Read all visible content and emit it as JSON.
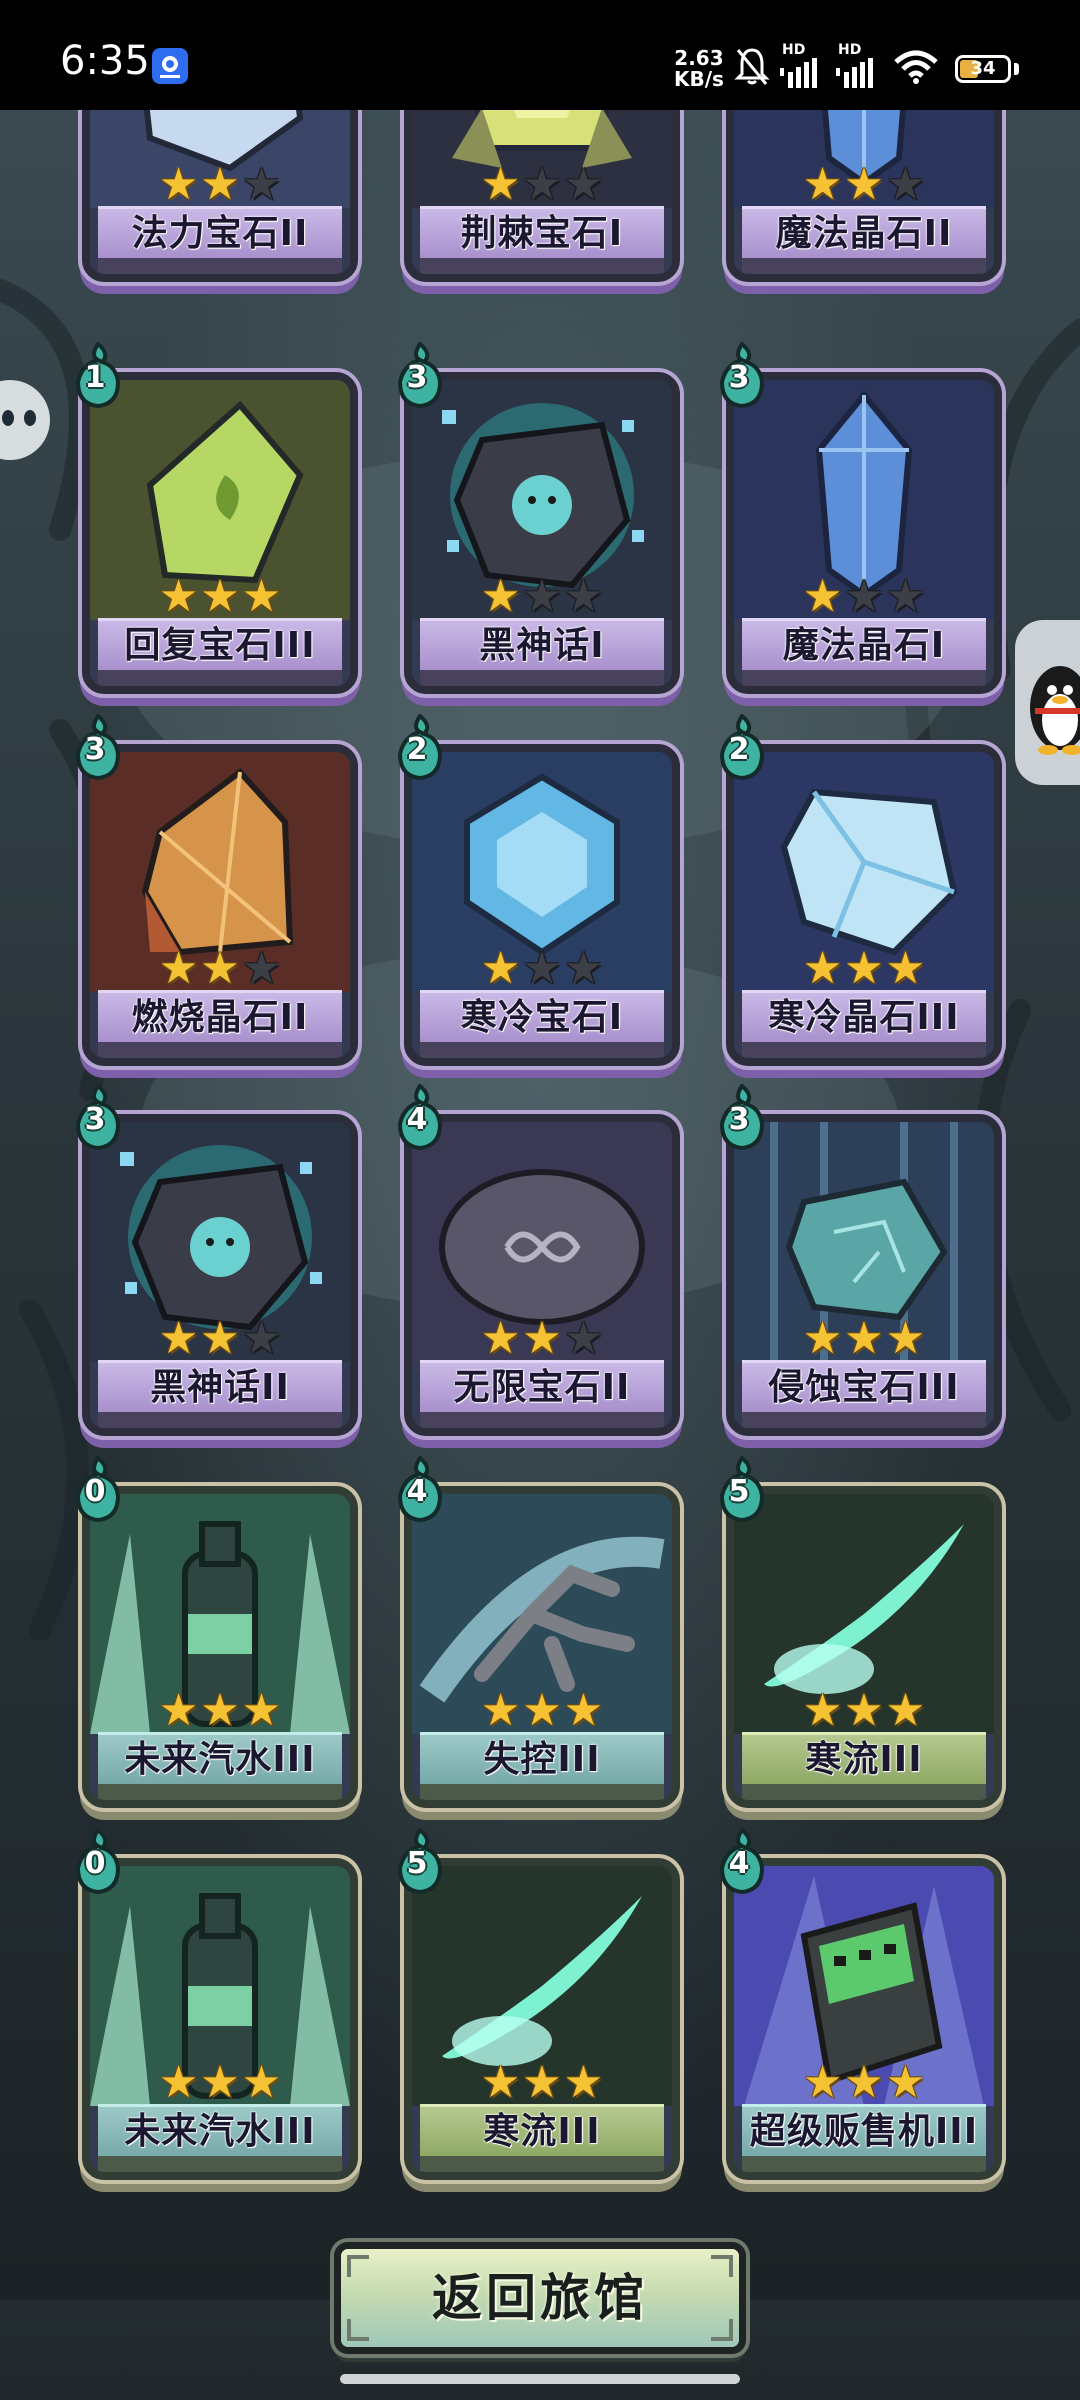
{
  "status_bar": {
    "time": "6:35",
    "speed_value": "2.63",
    "speed_unit": "KB/s",
    "network_1": "HD",
    "network_2": "HD",
    "battery": "34"
  },
  "cards": [
    {
      "name": "法力宝石II",
      "stars": 2,
      "cost": null,
      "kind": "item",
      "art": "stone-spiral"
    },
    {
      "name": "荆棘宝石I",
      "stars": 1,
      "cost": null,
      "kind": "item",
      "art": "gem-yellow"
    },
    {
      "name": "魔法晶石II",
      "stars": 2,
      "cost": null,
      "kind": "item",
      "art": "crystal-blue"
    },
    {
      "name": "回复宝石III",
      "stars": 3,
      "cost": "1",
      "kind": "item",
      "art": "gem-green"
    },
    {
      "name": "黑神话I",
      "stars": 1,
      "cost": "3",
      "kind": "item",
      "art": "dark-stone"
    },
    {
      "name": "魔法晶石I",
      "stars": 1,
      "cost": "3",
      "kind": "item",
      "art": "crystal-blue"
    },
    {
      "name": "燃烧晶石II",
      "stars": 2,
      "cost": "3",
      "kind": "item",
      "art": "crystal-orange"
    },
    {
      "name": "寒冷宝石I",
      "stars": 1,
      "cost": "2",
      "kind": "item",
      "art": "gem-ice"
    },
    {
      "name": "寒冷晶石III",
      "stars": 3,
      "cost": "2",
      "kind": "item",
      "art": "ice-chunk"
    },
    {
      "name": "黑神话II",
      "stars": 2,
      "cost": "3",
      "kind": "item",
      "art": "dark-stone"
    },
    {
      "name": "无限宝石II",
      "stars": 2,
      "cost": "4",
      "kind": "item",
      "art": "infinity-stone"
    },
    {
      "name": "侵蚀宝石III",
      "stars": 3,
      "cost": "3",
      "kind": "item",
      "art": "erosion-stone"
    },
    {
      "name": "未来汽水III",
      "stars": 3,
      "cost": "0",
      "kind": "skill",
      "art": "soda"
    },
    {
      "name": "失控III",
      "stars": 3,
      "cost": "4",
      "kind": "skill",
      "art": "claw"
    },
    {
      "name": "寒流III",
      "stars": 3,
      "cost": "5",
      "kind": "skill green",
      "art": "cold-wave"
    },
    {
      "name": "未来汽水III",
      "stars": 3,
      "cost": "0",
      "kind": "skill",
      "art": "soda"
    },
    {
      "name": "寒流III",
      "stars": 3,
      "cost": "5",
      "kind": "skill green",
      "art": "cold-wave"
    },
    {
      "name": "超级贩售机III",
      "stars": 3,
      "cost": "4",
      "kind": "skill",
      "art": "vending"
    }
  ],
  "return_button": "返回旅馆"
}
